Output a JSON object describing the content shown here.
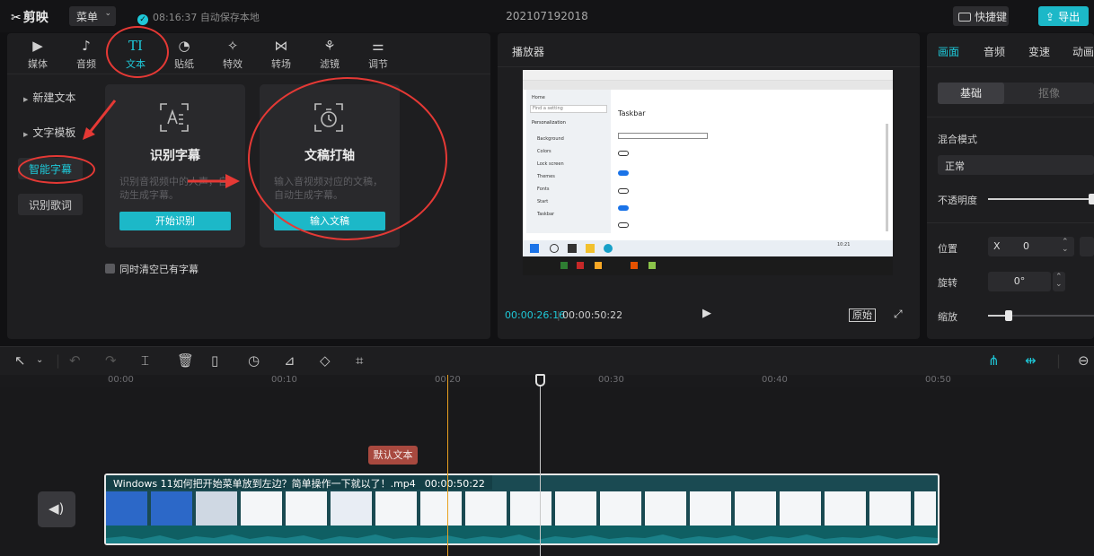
{
  "topbar": {
    "app_name": "剪映",
    "menu_label": "菜单",
    "save_status": "08:16:37 自动保存本地",
    "project_title": "202107192018",
    "shortcut_label": "快捷键",
    "export_label": "导出"
  },
  "material_tabs": [
    {
      "label": "媒体",
      "icon": "media-icon"
    },
    {
      "label": "音频",
      "icon": "audio-icon"
    },
    {
      "label": "文本",
      "icon": "text-icon",
      "active": true
    },
    {
      "label": "贴纸",
      "icon": "sticker-icon"
    },
    {
      "label": "特效",
      "icon": "effect-icon"
    },
    {
      "label": "转场",
      "icon": "transition-icon"
    },
    {
      "label": "滤镜",
      "icon": "filter-icon"
    },
    {
      "label": "调节",
      "icon": "adjust-icon"
    }
  ],
  "text_sidebar": {
    "new_text": "新建文本",
    "text_template": "文字模板",
    "smart_subtitle": "智能字幕",
    "lyrics_recognition": "识别歌词"
  },
  "cards": {
    "recognize": {
      "title": "识别字幕",
      "desc": "识别音视频中的人声，自动生成字幕。",
      "button": "开始识别"
    },
    "script": {
      "title": "文稿打轴",
      "desc": "输入音视频对应的文稿，自动生成字幕。",
      "button": "输入文稿"
    },
    "clear_checkbox": "同时清空已有字幕"
  },
  "player": {
    "title": "播放器",
    "current_time": "00:00:26:16",
    "total_time": "00:00:50:22",
    "ratio_label": "原始"
  },
  "screen_content": {
    "settings_heading": "Taskbar",
    "settings_nav": [
      "Home",
      "Find a setting",
      "Personalization",
      "Background",
      "Colors",
      "Lock screen",
      "Themes",
      "Fonts",
      "Start",
      "Taskbar"
    ],
    "clock": "10:21"
  },
  "inspector": {
    "tabs": [
      "画面",
      "音频",
      "变速",
      "动画"
    ],
    "seg_basic": "基础",
    "seg_matte": "抠像",
    "blend_label": "混合模式",
    "blend_value": "正常",
    "opacity_label": "不透明度",
    "position_label": "位置",
    "x_label": "X",
    "x_value": "0",
    "rotate_label": "旋转",
    "rotate_value": "0°",
    "scale_label": "缩放"
  },
  "timeline": {
    "ticks": [
      "00:00",
      "00:10",
      "00:20",
      "00:30",
      "00:40",
      "00:50"
    ],
    "text_clip_label": "默认文本",
    "clip_name": "Windows 11如何把开始菜单放到左边？简单操作一下就以了！.mp4",
    "clip_duration": "00:00:50:22"
  },
  "colors": {
    "accent": "#1ec8d8",
    "annotation": "#e53935",
    "text_clip": "#a8493f",
    "video_track": "#1a4a52"
  }
}
